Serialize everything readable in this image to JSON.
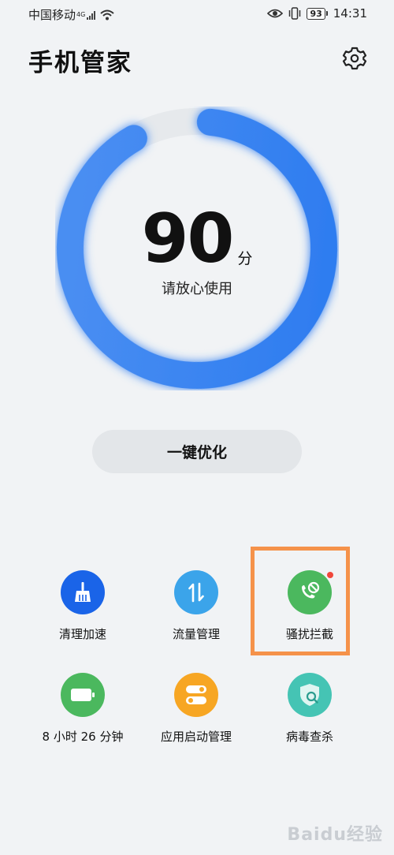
{
  "status_bar": {
    "carrier": "中国移动",
    "network": "4G",
    "battery": "93",
    "time": "14:31"
  },
  "header": {
    "title": "手机管家",
    "settings_icon": "gear-icon"
  },
  "score": {
    "value": "90",
    "unit": "分",
    "status": "请放心使用",
    "ring_fraction": 0.9
  },
  "optimize_button": {
    "label": "一键优化"
  },
  "tools": [
    {
      "label": "清理加速",
      "icon": "broom-icon",
      "color": "#1a64e8"
    },
    {
      "label": "流量管理",
      "icon": "data-transfer-icon",
      "color": "#3ba4ea"
    },
    {
      "label": "骚扰拦截",
      "icon": "blocked-call-icon",
      "color": "#4bb85e",
      "badge_color": "#f0473b"
    },
    {
      "label": "8 小时 26 分钟",
      "icon": "battery-icon",
      "color": "#4bb85e"
    },
    {
      "label": "应用启动管理",
      "icon": "toggle-switches-icon",
      "color": "#f7a623"
    },
    {
      "label": "病毒查杀",
      "icon": "shield-search-icon",
      "color": "#45c4b4"
    }
  ],
  "colors": {
    "accent": "#3d86f0",
    "ring_track": "#e6e9ec",
    "highlight_border": "#f5924a"
  },
  "watermark": "Baidu经验"
}
